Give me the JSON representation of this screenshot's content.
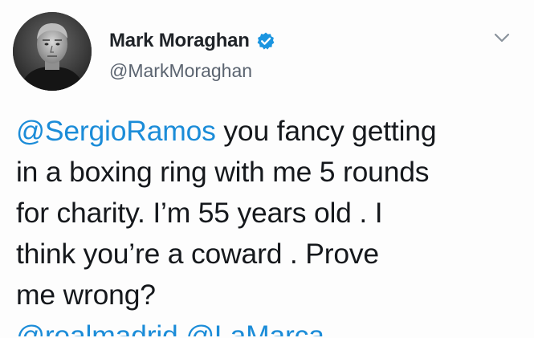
{
  "user": {
    "display_name": "Mark Moraghan",
    "handle": "@MarkMoraghan",
    "verified": true
  },
  "tweet": {
    "mention_lead": "@SergioRamos",
    "line1_rest": " you fancy getting",
    "line2": "in a boxing ring with me 5 rounds",
    "line3": "for charity. I’m 55 years old .  I",
    "line4": "think you’re a coward . Prove",
    "line5": "me wrong?",
    "trailing_mentions": [
      "@realmadrid",
      "@LaMarca"
    ]
  },
  "icons": {
    "verified": "verified-badge-icon",
    "menu": "chevron-down-icon"
  },
  "colors": {
    "link": "#1b8cd8",
    "verified": "#1b95e0",
    "text": "#15181c",
    "muted": "#5b6470"
  }
}
